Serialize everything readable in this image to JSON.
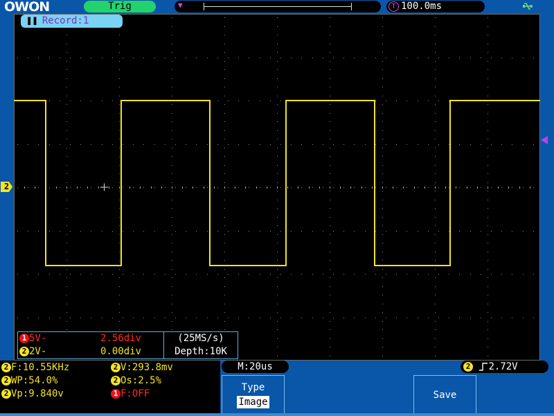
{
  "header": {
    "logo": "OWON",
    "trigger_status": "Trig",
    "timebase": "100.0ms",
    "timebase_icon": "T"
  },
  "record": {
    "label": "Record:1"
  },
  "channel_marker": "2",
  "cursors": {
    "row1_channel": "1",
    "row1_label": "5V-",
    "row1_value": "2.56div",
    "row2_channel": "2",
    "row2_label": "2V-",
    "row2_value": "0.00div"
  },
  "acquisition": {
    "sample_rate": "(25MS/s)",
    "depth": "Depth:10K"
  },
  "measurements": {
    "m1_ch": "2",
    "m1": "F:10.55KHz",
    "m2_ch": "2",
    "m2": "V:293.8mv",
    "m3_ch": "2",
    "m3": "WP:54.0%",
    "m4_ch": "2",
    "m4": "Os:2.5%",
    "m5_ch": "2",
    "m5": "Vp:9.840v",
    "m6_ch": "1",
    "m6": "F:OFF"
  },
  "status": {
    "horizontal": "M:20us",
    "trigger_channel": "2",
    "trigger_level": "2.72V"
  },
  "menu": {
    "type_label": "Type",
    "type_value": "Image",
    "save_label": "Save"
  },
  "colors": {
    "ch1": "#e8131b",
    "ch2": "#f4e422",
    "background": "#0a56a8",
    "grid": "#8c8c8c"
  },
  "icons": [
    "usb-icon",
    "pause-icon",
    "trigger-edge-icon"
  ]
}
